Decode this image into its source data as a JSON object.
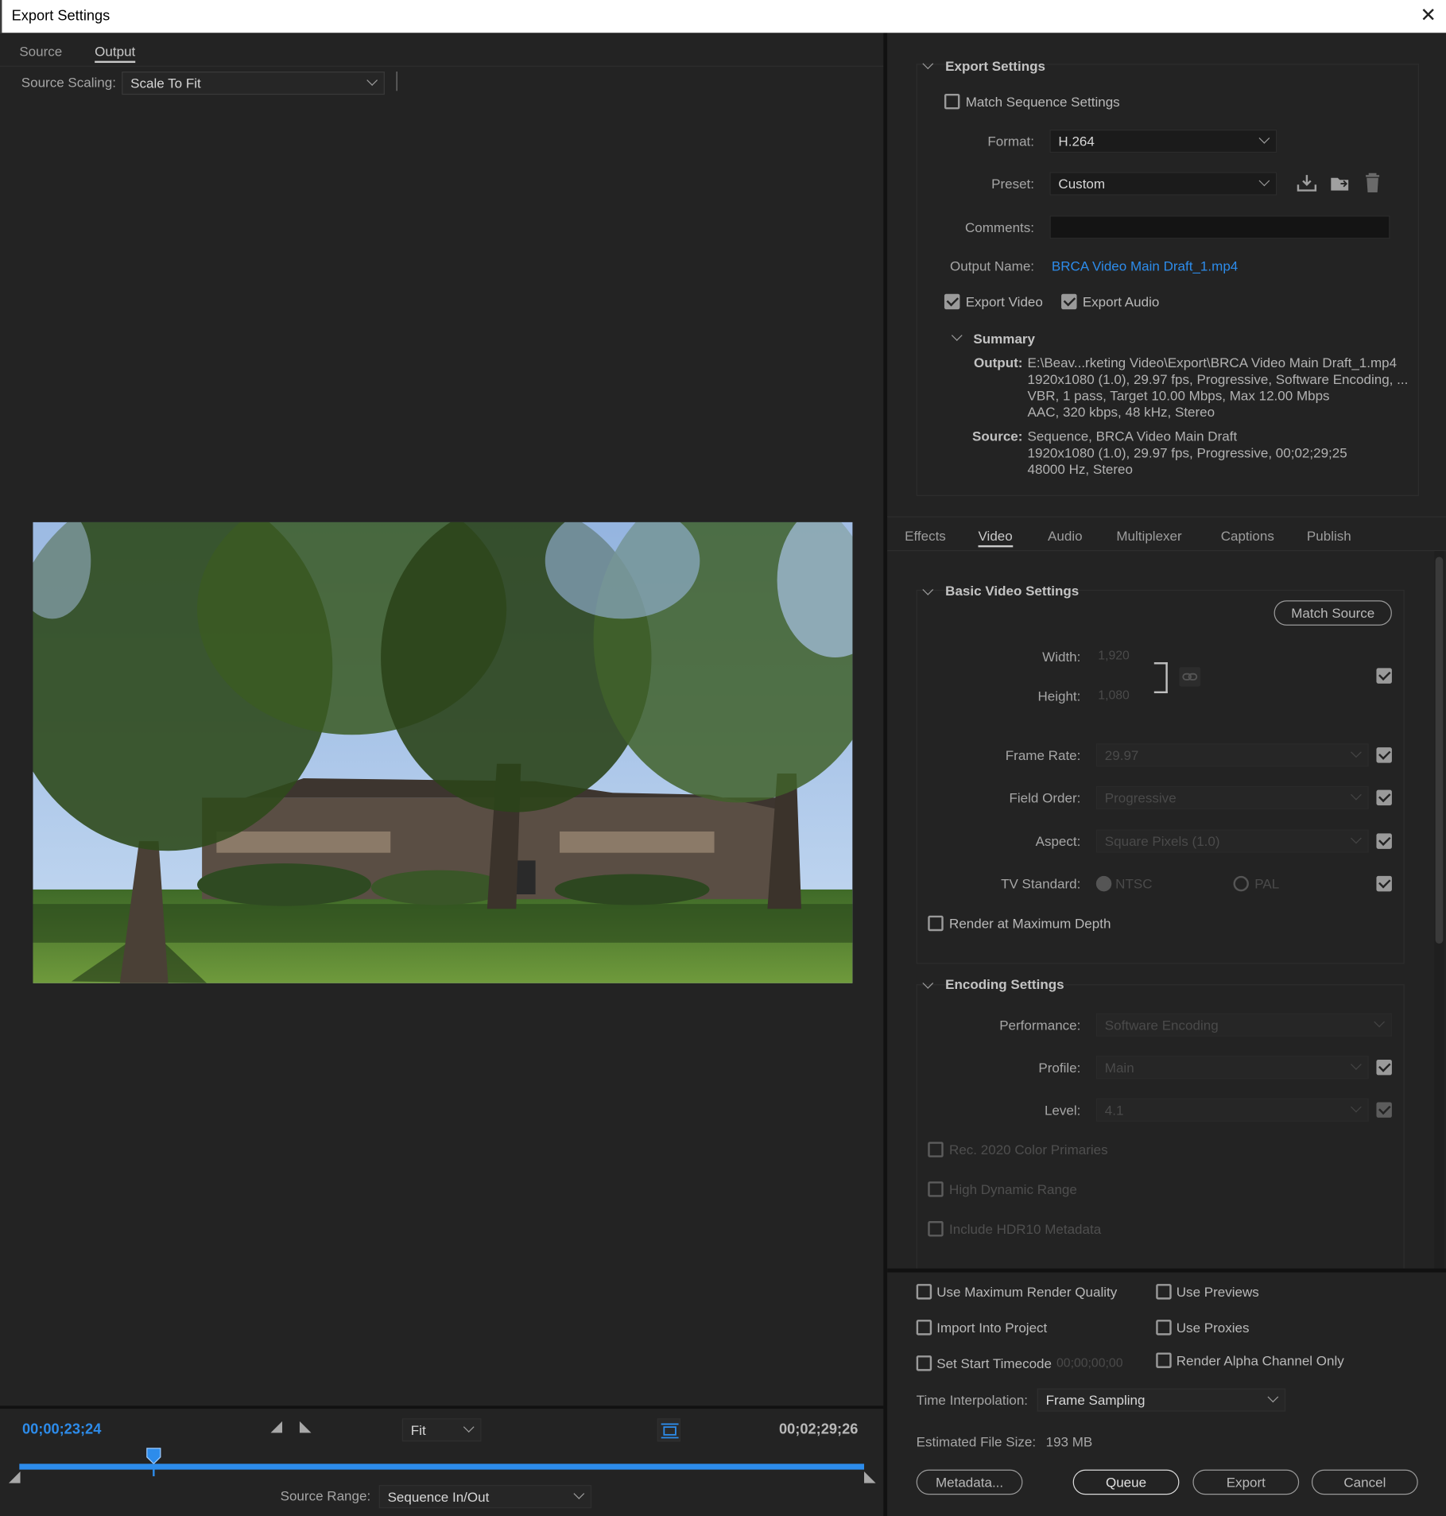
{
  "window": {
    "title": "Export Settings",
    "close_glyph": "✕"
  },
  "left": {
    "tabs": [
      "Source",
      "Output"
    ],
    "active_tab": "Output",
    "source_scaling_label": "Source Scaling:",
    "source_scaling_value": "Scale To Fit",
    "timeline": {
      "current_tc": "00;00;23;24",
      "end_tc": "00;02;29;26",
      "zoom": "Fit",
      "playhead_fraction": 0.159,
      "source_range_label": "Source Range:",
      "source_range_value": "Sequence In/Out"
    }
  },
  "export_settings": {
    "header": "Export Settings",
    "match_sequence": {
      "label": "Match Sequence Settings",
      "checked": false
    },
    "format_label": "Format:",
    "format_value": "H.264",
    "preset_label": "Preset:",
    "preset_value": "Custom",
    "comments_label": "Comments:",
    "comments_value": "",
    "output_name_label": "Output Name:",
    "output_name_value": "BRCA Video Main Draft_1.mp4",
    "export_video": {
      "label": "Export Video",
      "checked": true
    },
    "export_audio": {
      "label": "Export Audio",
      "checked": true
    },
    "summary": {
      "header": "Summary",
      "output_key": "Output:",
      "output_lines": [
        "E:\\Beav...rketing Video\\Export\\BRCA Video Main Draft_1.mp4",
        "1920x1080 (1.0), 29.97 fps, Progressive, Software Encoding, ...",
        "VBR, 1 pass, Target 10.00 Mbps, Max 12.00 Mbps",
        "AAC, 320 kbps, 48 kHz, Stereo"
      ],
      "source_key": "Source:",
      "source_lines": [
        "Sequence, BRCA Video Main Draft",
        "1920x1080 (1.0), 29.97 fps, Progressive, 00;02;29;25",
        "48000 Hz, Stereo"
      ]
    }
  },
  "settings_tabs": [
    "Effects",
    "Video",
    "Audio",
    "Multiplexer",
    "Captions",
    "Publish"
  ],
  "active_settings_tab": "Video",
  "basic_video": {
    "header": "Basic Video Settings",
    "match_source": "Match Source",
    "width_label": "Width:",
    "width_value": "1,920",
    "height_label": "Height:",
    "height_value": "1,080",
    "frame_rate_label": "Frame Rate:",
    "frame_rate_value": "29.97",
    "field_order_label": "Field Order:",
    "field_order_value": "Progressive",
    "aspect_label": "Aspect:",
    "aspect_value": "Square Pixels (1.0)",
    "tv_standard_label": "TV Standard:",
    "ntsc": "NTSC",
    "pal": "PAL",
    "render_max_depth": "Render at Maximum Depth"
  },
  "encoding": {
    "header": "Encoding Settings",
    "performance_label": "Performance:",
    "performance_value": "Software Encoding",
    "profile_label": "Profile:",
    "profile_value": "Main",
    "level_label": "Level:",
    "level_value": "4.1",
    "rec2020": "Rec. 2020 Color Primaries",
    "hdr": "High Dynamic Range",
    "hdr10": "Include HDR10 Metadata"
  },
  "bottom": {
    "use_max_render_quality": "Use Maximum Render Quality",
    "use_previews": "Use Previews",
    "import_into_project": "Import Into Project",
    "use_proxies": "Use Proxies",
    "set_start_timecode": "Set Start Timecode",
    "start_timecode_value": "00;00;00;00",
    "render_alpha_only": "Render Alpha Channel Only",
    "time_interpolation_label": "Time Interpolation:",
    "time_interpolation_value": "Frame Sampling",
    "estimated_file_size_label": "Estimated File Size:",
    "estimated_file_size_value": "193 MB",
    "buttons": {
      "metadata": "Metadata...",
      "queue": "Queue",
      "export": "Export",
      "cancel": "Cancel"
    }
  },
  "colors": {
    "accent": "#2d8ceb",
    "panel": "#232323",
    "input": "#1b1b1b"
  }
}
